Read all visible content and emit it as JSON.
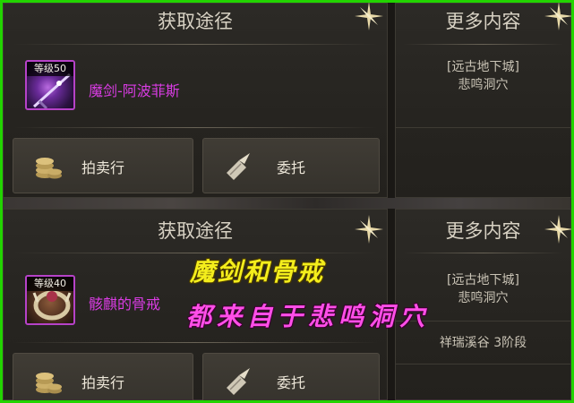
{
  "top": {
    "acquire_panel": {
      "title": "获取途径",
      "item": {
        "level": "等级50",
        "name": "魔剑-阿波菲斯"
      },
      "buttons": {
        "auction": "拍卖行",
        "commission": "委托"
      }
    },
    "more_panel": {
      "title": "更多内容",
      "source_line1": "[远古地下城]",
      "source_line2": "悲鸣洞穴"
    }
  },
  "bottom": {
    "acquire_panel": {
      "title": "获取途径",
      "item": {
        "level": "等级40",
        "name": "骸麒的骨戒"
      },
      "buttons": {
        "auction": "拍卖行",
        "commission": "委托"
      }
    },
    "more_panel": {
      "title": "更多内容",
      "source_line1": "[远古地下城]",
      "source_line2": "悲鸣洞穴",
      "source_line3": "祥瑞溪谷 3阶段"
    }
  },
  "overlay": {
    "line1": "魔剑和骨戒",
    "line2": "都来自于悲鸣洞穴"
  },
  "colors": {
    "frame": "#22d400",
    "item_name": "#d83ce2",
    "overlay_line1": "#f4ee1c",
    "overlay_line2": "#ff4ee8"
  }
}
